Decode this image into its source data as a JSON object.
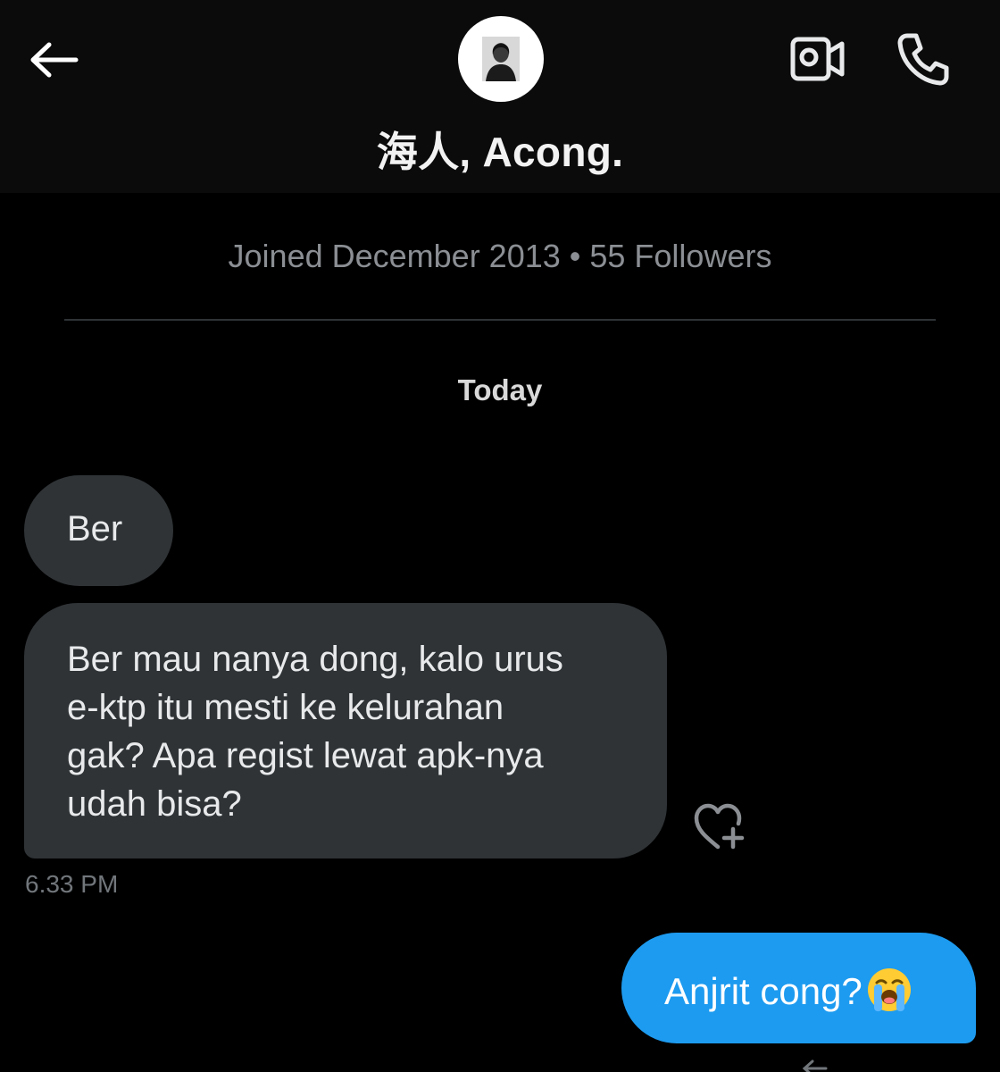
{
  "header": {
    "title": "海人, Acong.",
    "back_icon": "arrow-left-icon",
    "video_icon": "video-camera-icon",
    "call_icon": "phone-icon",
    "avatar": "profile-avatar"
  },
  "profile": {
    "joined_text": "Joined December 2013 • 55 Followers"
  },
  "conversation": {
    "day_label": "Today",
    "incoming": [
      {
        "text": "Ber"
      },
      {
        "lines": [
          "Ber mau nanya dong, kalo urus",
          "e-ktp itu mesti ke kelurahan",
          "gak? Apa regist lewat apk-nya",
          "udah bisa?"
        ]
      }
    ],
    "incoming_time": "6.33 PM",
    "outgoing": [
      {
        "text": "Anjrit cong?",
        "emoji": "loudly-crying-face"
      }
    ]
  },
  "colors": {
    "background": "#000000",
    "incoming_bubble": "#2f3336",
    "outgoing_bubble": "#1d9bf0",
    "muted_text": "#71767b"
  }
}
